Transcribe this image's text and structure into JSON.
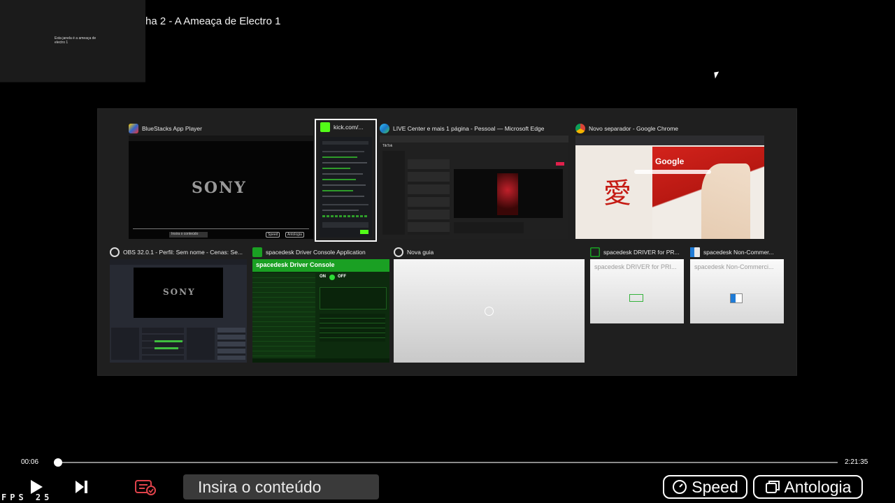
{
  "mini_preview": {
    "text": "Esta janela é a ameaça de electro 1"
  },
  "video": {
    "title": "ha 2 - A Ameaça de Electro 1"
  },
  "switcher": {
    "windows": [
      {
        "title": "BlueStacks App Player",
        "icon": "bluestacks-icon",
        "content_logo": "SONY",
        "input_placeholder": "Insira o conteúdo",
        "speed_label": "Speed",
        "antologia_label": "Antologia"
      },
      {
        "title": "kick.com/...",
        "icon": "kick-icon",
        "selected": true
      },
      {
        "title": "LIVE Center e mais 1 página - Pessoal — Microsoft Edge",
        "icon": "edge-icon",
        "tab": "TikTok"
      },
      {
        "title": "Novo separador - Google Chrome",
        "icon": "chrome-icon",
        "logo": "Google",
        "kanji": "愛"
      },
      {
        "title": "OBS 32.0.1 - Perfil: Sem nome - Cenas: Se...",
        "icon": "obs-icon",
        "content_logo": "SONY"
      },
      {
        "title": "spacedesk Driver Console Application",
        "icon": "spacedesk-icon",
        "heading": "spacedesk Driver Console",
        "on": "ON",
        "off": "OFF"
      },
      {
        "title": "Nova guia",
        "icon": "globe-icon"
      },
      {
        "title": "spacedesk DRIVER for PR...",
        "icon": "spacedesk-icon",
        "inner_title": "spacedesk DRIVER for PRI..."
      },
      {
        "title": "spacedesk Non-Commer...",
        "icon": "spacedesk-window-icon",
        "inner_title": "spacedesk Non-Commerci..."
      }
    ]
  },
  "player": {
    "current_time": "00:06",
    "total_time": "2:21:35",
    "progress": 0.0007,
    "fps_label": "FPS",
    "fps_value": "25",
    "input_placeholder": "Insira o conteúdo",
    "speed_label": "Speed",
    "antologia_label": "Antologia"
  },
  "colors": {
    "accent_green": "#23c32a",
    "selection": "#ffffff",
    "panel": "#1f1f1f"
  }
}
